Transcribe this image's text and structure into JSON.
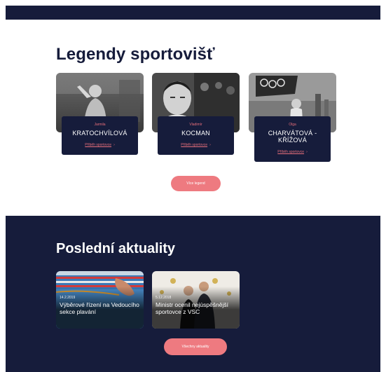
{
  "legends": {
    "title": "Legendy sportovišť",
    "items": [
      {
        "first_name": "Jarmila",
        "last_name": "KRATOCHVÍLOVÁ",
        "link": "Příběh sportovce",
        "arrow": "›"
      },
      {
        "first_name": "Vladimír",
        "last_name": "KOCMAN",
        "link": "Příběh sportovce",
        "arrow": "›"
      },
      {
        "first_name": "Olga",
        "last_name": "CHARVÁTOVÁ - KŘÍŽOVÁ",
        "link": "Příběh sportovce",
        "arrow": "›"
      }
    ],
    "more_button": "Více legend"
  },
  "news": {
    "title": "Poslední aktuality",
    "items": [
      {
        "date": "14.2.2019",
        "headline": "Výběrové řízení na Vedoucího sekce plavání"
      },
      {
        "date": "5.12.2018",
        "headline": "Ministr ocenil nejúspěšnější sportovce z VSC"
      }
    ],
    "all_button": "Všechny aktuality"
  },
  "colors": {
    "navy": "#161c3b",
    "accent": "#ee7a80",
    "accent_text": "#e86f7b",
    "white": "#ffffff"
  }
}
